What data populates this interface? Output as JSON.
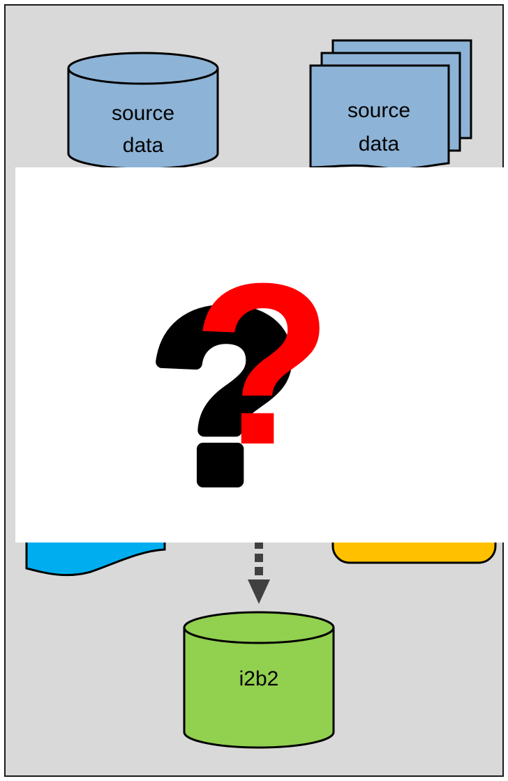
{
  "diagram": {
    "colors": {
      "frame_background": "#d9d9d9",
      "frame_border": "#1a1a1a",
      "source_fill": "#8db3d6",
      "stroke": "#000000",
      "document_fill": "#00aeef",
      "process_fill": "#ffc000",
      "i2b2_fill": "#92d050",
      "arrow": "#404040",
      "overlay": "#ffffff",
      "question_red": "#ff0000",
      "question_shadow": "#000000"
    },
    "source_database": {
      "icon": "database-cylinder-icon",
      "label_line1": "source",
      "label_line2": "data"
    },
    "source_documents": {
      "icon": "stacked-documents-icon",
      "label_line1": "source",
      "label_line2": "data"
    },
    "hidden_document": {
      "icon": "document-icon"
    },
    "hidden_process": {
      "icon": "rounded-box-icon"
    },
    "overlay": {
      "symbol": "?",
      "icon": "question-mark-icon"
    },
    "i2b2_database": {
      "icon": "database-cylinder-icon",
      "label": "i2b2"
    },
    "connector": {
      "style": "dotted-arrow"
    }
  }
}
